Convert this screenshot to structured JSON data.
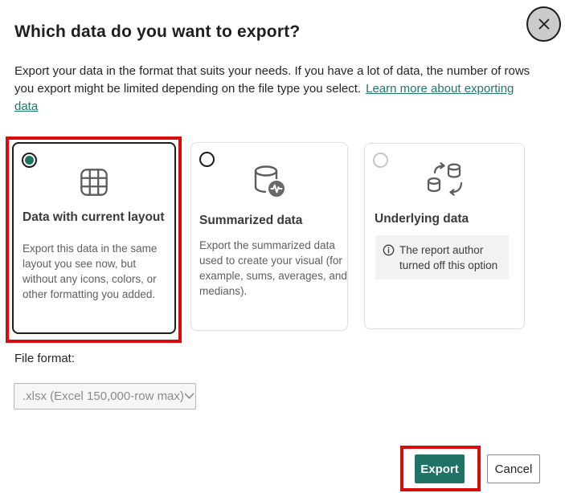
{
  "dialog": {
    "title": "Which data do you want to export?",
    "description": "Export your data in the format that suits your needs. If you have a lot of data, the number of rows you export might be limited depending on the file type you select.",
    "learn_more": "Learn more about exporting data"
  },
  "options": [
    {
      "title": "Data with current layout",
      "description": "Export this data in the same layout you see now, but without any icons, colors, or other formatting you added.",
      "selected": true,
      "icon": "table-grid-icon"
    },
    {
      "title": "Summarized data",
      "description": "Export the summarized data used to create your visual (for example, sums, averages, and medians).",
      "selected": false,
      "icon": "database-pulse-icon"
    },
    {
      "title": "Underlying data",
      "notice": "The report author turned off this option",
      "selected": false,
      "disabled": true,
      "icon": "database-sync-icon"
    }
  ],
  "file_format": {
    "label": "File format:",
    "value": ".xlsx (Excel 150,000-row max)"
  },
  "actions": {
    "export": "Export",
    "cancel": "Cancel"
  },
  "colors": {
    "accent": "#1f7365",
    "link": "#1f7868",
    "annotation": "#da0b0b"
  }
}
